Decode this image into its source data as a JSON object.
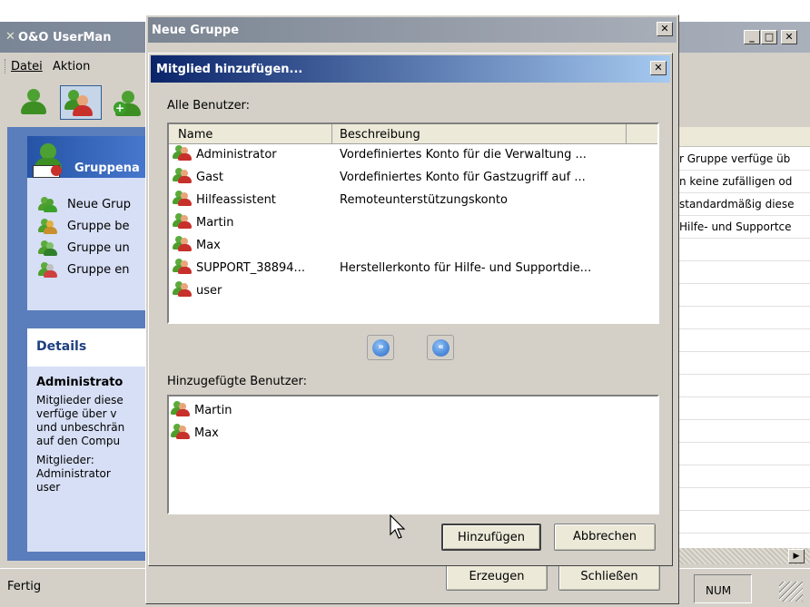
{
  "main_window": {
    "title": "O&O UserMan",
    "menu": [
      "Datei",
      "Aktion"
    ],
    "task_header": "Gruppena",
    "tasks": [
      "Neue Grup",
      "Gruppe be",
      "Gruppe un",
      "Gruppe en"
    ],
    "details": {
      "header": "Details",
      "title": "Administrato",
      "description_lines": [
        "Mitglieder diese",
        "verfüge über v",
        "und unbeschrän",
        "auf den Compu"
      ],
      "members_label": "Mitglieder:",
      "members": [
        "Administrator",
        "user"
      ]
    },
    "right_rows": [
      "r Gruppe verfüge üb",
      "n keine zufälligen od",
      "standardmäßig diese",
      "Hilfe- und Supportce"
    ],
    "status_left": "Fertig",
    "status_num": "NUM"
  },
  "group_dialog": {
    "title": "Neue Gruppe",
    "create_button": "Erzeugen",
    "close_button": "Schließen"
  },
  "add_member_dialog": {
    "title": "Mitglied hinzufügen...",
    "all_users_label": "Alle Benutzer:",
    "columns": [
      "Name",
      "Beschreibung"
    ],
    "users": [
      {
        "name": "Administrator",
        "description": "Vordefiniertes Konto für die Verwaltung ..."
      },
      {
        "name": "Gast",
        "description": "Vordefiniertes Konto für Gastzugriff auf ..."
      },
      {
        "name": "Hilfeassistent",
        "description": "Remoteunterstützungskonto"
      },
      {
        "name": "Martin",
        "description": ""
      },
      {
        "name": "Max",
        "description": ""
      },
      {
        "name": "SUPPORT_38894...",
        "description": "Herstellerkonto für Hilfe- und Supportdie..."
      },
      {
        "name": "user",
        "description": ""
      }
    ],
    "added_users_label": "Hinzugefügte Benutzer:",
    "added_users": [
      "Martin",
      "Max"
    ],
    "add_button": "Hinzufügen",
    "cancel_button": "Abbrechen"
  }
}
